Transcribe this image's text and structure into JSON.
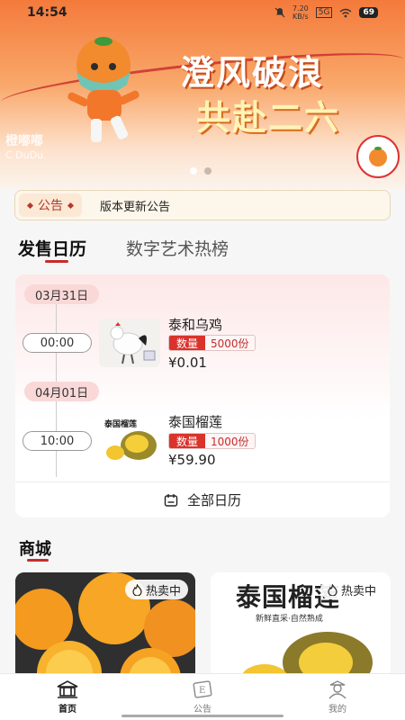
{
  "status_bar": {
    "time": "14:54",
    "speed_value": "7.20",
    "speed_unit": "KB/s",
    "network": "5G",
    "battery": "69"
  },
  "banner": {
    "title_line1": "澄风破浪",
    "title_line2": "共赴二六",
    "brand_cn": "橙嘟嘟",
    "brand_en": "C DuDu",
    "seal_text": "C DuDu",
    "dots_total": 2,
    "dots_active": 1
  },
  "notice": {
    "tag": "公告",
    "text": "版本更新公告"
  },
  "tabs": [
    {
      "label": "发售日历",
      "active": true
    },
    {
      "label": "数字艺术热榜",
      "active": false
    }
  ],
  "calendar": {
    "entries": [
      {
        "date": "03月31日",
        "time": "00:00",
        "name": "泰和乌鸡",
        "stock_label": "数量",
        "stock_value": "5000份",
        "price": "¥0.01"
      },
      {
        "date": "04月01日",
        "time": "10:00",
        "name": "泰国榴莲",
        "thumb_text": "泰国榴莲",
        "stock_label": "数量",
        "stock_value": "1000份",
        "price": "¥59.90"
      }
    ],
    "footer": "全部日历"
  },
  "mall": {
    "title": "商城",
    "goods": [
      {
        "badge": "热卖中"
      },
      {
        "badge": "热卖中",
        "headline": "泰国榴莲",
        "tagline": "新鲜直采·自然熟成"
      }
    ]
  },
  "nav": [
    {
      "label": "首页",
      "icon": "home-icon",
      "active": true
    },
    {
      "label": "公告",
      "icon": "notice-icon",
      "active": false
    },
    {
      "label": "我的",
      "icon": "profile-icon",
      "active": false
    }
  ],
  "colors": {
    "accent": "#c62b2b",
    "banner": "#f47a3b",
    "stock_tag": "#d9332c"
  }
}
